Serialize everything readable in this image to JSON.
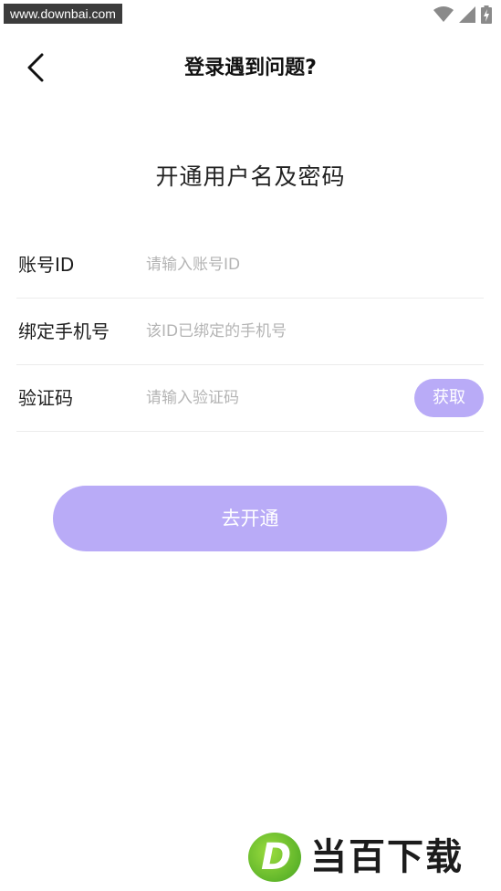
{
  "status_bar": {
    "watermark": "www.downbai.com",
    "icons": [
      "wifi-icon",
      "signal-icon",
      "battery-charging-icon"
    ]
  },
  "header": {
    "back_icon": "chevron-left-icon",
    "title": "登录遇到问题?"
  },
  "section_title": "开通用户名及密码",
  "form": {
    "account": {
      "label": "账号ID",
      "placeholder": "请输入账号ID",
      "value": ""
    },
    "phone": {
      "label": "绑定手机号",
      "placeholder": "该ID已绑定的手机号",
      "value": ""
    },
    "code": {
      "label": "验证码",
      "placeholder": "请输入验证码",
      "value": "",
      "button": "获取"
    }
  },
  "submit_label": "去开通",
  "brand": {
    "mark": "D",
    "text": "当百下载"
  },
  "colors": {
    "accent": "#b9abf7",
    "text": "#1e1e1e",
    "placeholder": "#b4b4b4",
    "divider": "#ececec"
  }
}
